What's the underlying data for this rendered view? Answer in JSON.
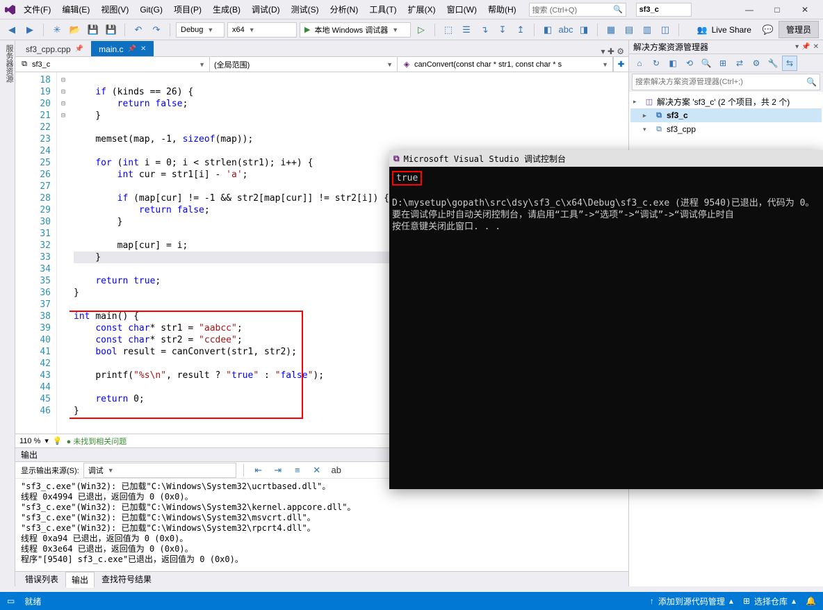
{
  "menu": {
    "file": "文件(F)",
    "edit": "编辑(E)",
    "view": "视图(V)",
    "git": "Git(G)",
    "project": "项目(P)",
    "build": "生成(B)",
    "debug": "调试(D)",
    "test": "测试(S)",
    "analyze": "分析(N)",
    "tools": "工具(T)",
    "extensions": "扩展(X)",
    "window": "窗口(W)",
    "help": "帮助(H)"
  },
  "search_placeholder": "搜索 (Ctrl+Q)",
  "solution_pill": "sf3_c",
  "window_buttons": {
    "minimize": "—",
    "maximize": "□",
    "close": "✕"
  },
  "toolbar": {
    "config": "Debug",
    "platform": "x64",
    "run_label": "本地 Windows 调试器",
    "liveshare": "Live Share",
    "admin": "管理员"
  },
  "filetabs": [
    {
      "name": "sf3_cpp.cpp",
      "active": false,
      "pin": true
    },
    {
      "name": "main.c",
      "active": true,
      "pin": true
    }
  ],
  "navbar": {
    "scope": "sf3_c",
    "scope2": "(全局范围)",
    "member": "canConvert(const char * str1, const char * s"
  },
  "code_lines": [
    {
      "n": 18,
      "t": ""
    },
    {
      "n": 19,
      "t": "    if (kinds == 26) {",
      "fold": "-"
    },
    {
      "n": 20,
      "t": "        return false;"
    },
    {
      "n": 21,
      "t": "    }"
    },
    {
      "n": 22,
      "t": ""
    },
    {
      "n": 23,
      "t": "    memset(map, -1, sizeof(map));"
    },
    {
      "n": 24,
      "t": ""
    },
    {
      "n": 25,
      "t": "    for (int i = 0; i < strlen(str1); i++) {",
      "fold": "-"
    },
    {
      "n": 26,
      "t": "        int cur = str1[i] - 'a';"
    },
    {
      "n": 27,
      "t": ""
    },
    {
      "n": 28,
      "t": "        if (map[cur] != -1 && str2[map[cur]] != str2[i]) {",
      "fold": "-"
    },
    {
      "n": 29,
      "t": "            return false;"
    },
    {
      "n": 30,
      "t": "        }"
    },
    {
      "n": 31,
      "t": ""
    },
    {
      "n": 32,
      "t": "        map[cur] = i;"
    },
    {
      "n": 33,
      "t": "    }",
      "cur": true
    },
    {
      "n": 34,
      "t": ""
    },
    {
      "n": 35,
      "t": "    return true;"
    },
    {
      "n": 36,
      "t": "}"
    },
    {
      "n": 37,
      "t": ""
    },
    {
      "n": 38,
      "t": "int main() {",
      "fold": "-"
    },
    {
      "n": 39,
      "t": "    const char* str1 = \"aabcc\";"
    },
    {
      "n": 40,
      "t": "    const char* str2 = \"ccdee\";"
    },
    {
      "n": 41,
      "t": "    bool result = canConvert(str1, str2);"
    },
    {
      "n": 42,
      "t": ""
    },
    {
      "n": 43,
      "t": "    printf(\"%s\\n\", result ? \"true\" : \"false\");"
    },
    {
      "n": 44,
      "t": ""
    },
    {
      "n": 45,
      "t": "    return 0;"
    },
    {
      "n": 46,
      "t": "}"
    }
  ],
  "zoom": {
    "level": "110 %",
    "issue": "未找到相关问题"
  },
  "output": {
    "title": "输出",
    "src_label": "显示输出来源(S):",
    "src_value": "调试",
    "lines": [
      "\"sf3_c.exe\"(Win32): 已加载\"C:\\Windows\\System32\\ucrtbased.dll\"。",
      "线程 0x4994 已退出，返回值为 0 (0x0)。",
      "\"sf3_c.exe\"(Win32): 已加载\"C:\\Windows\\System32\\kernel.appcore.dll\"。",
      "\"sf3_c.exe\"(Win32): 已加载\"C:\\Windows\\System32\\msvcrt.dll\"。",
      "\"sf3_c.exe\"(Win32): 已加载\"C:\\Windows\\System32\\rpcrt4.dll\"。",
      "线程 0xa94 已退出，返回值为 0 (0x0)。",
      "线程 0x3e64 已退出，返回值为 0 (0x0)。",
      "程序\"[9540] sf3_c.exe\"已退出，返回值为 0 (0x0)。"
    ],
    "tabs": {
      "errors": "错误列表",
      "output": "输出",
      "find": "查找符号结果"
    }
  },
  "explorer": {
    "title": "解决方案资源管理器",
    "search_placeholder": "搜索解决方案资源管理器(Ctrl+;)",
    "solution": "解决方案 'sf3_c' (2 个项目，共 2 个)",
    "projects": [
      {
        "name": "sf3_c",
        "bold": true,
        "sel": true
      },
      {
        "name": "sf3_cpp",
        "bold": false
      }
    ]
  },
  "status": {
    "ready": "就绪",
    "add_src": "添加到源代码管理",
    "select_repo": "选择仓库"
  },
  "console": {
    "title": "Microsoft Visual Studio 调试控制台",
    "out": "true",
    "exit": "D:\\mysetup\\gopath\\src\\dsy\\sf3_c\\x64\\Debug\\sf3_c.exe (进程 9540)已退出，代码为 0。",
    "hint": "要在调试停止时自动关闭控制台，请启用“工具”->“选项”->“调试”->“调试停止时自",
    "press": "按任意键关闭此窗口. . ."
  }
}
